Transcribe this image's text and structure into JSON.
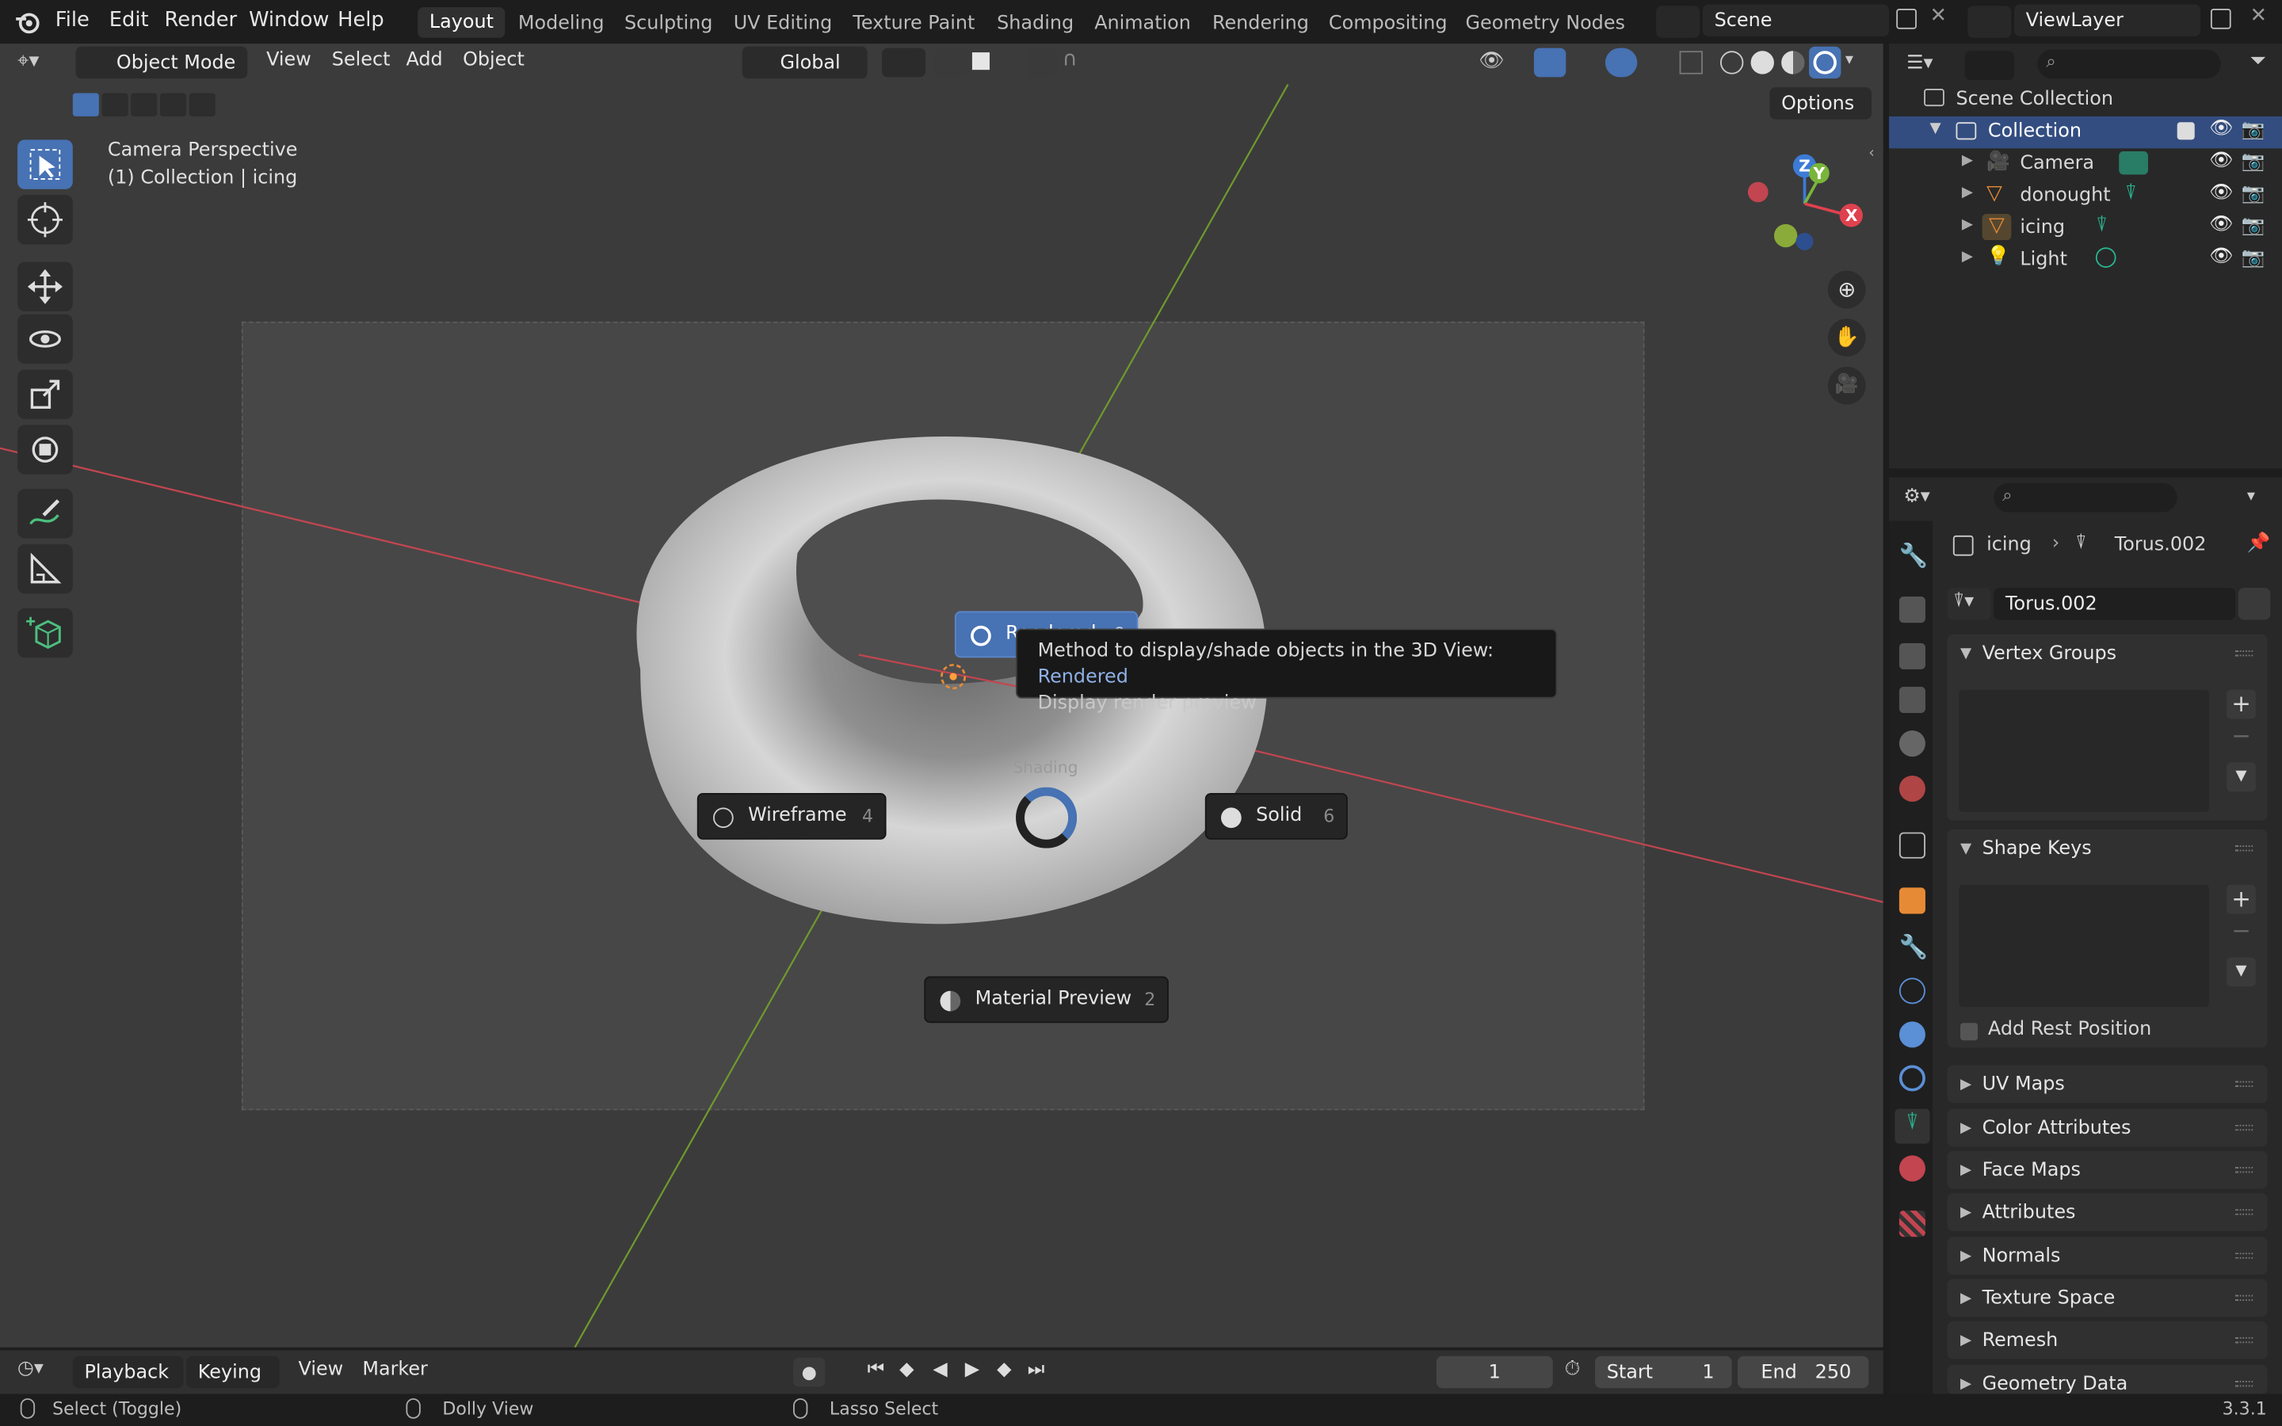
{
  "topbar": {
    "menus": [
      "File",
      "Edit",
      "Render",
      "Window",
      "Help"
    ],
    "workspaces": [
      "Layout",
      "Modeling",
      "Sculpting",
      "UV Editing",
      "Texture Paint",
      "Shading",
      "Animation",
      "Rendering",
      "Compositing",
      "Geometry Nodes"
    ],
    "active_workspace": "Layout",
    "scene": "Scene",
    "view_layer": "ViewLayer"
  },
  "viewport_header": {
    "mode": "Object Mode",
    "menus": [
      "View",
      "Select",
      "Add",
      "Object"
    ],
    "orientation": "Global",
    "options": "Options"
  },
  "viewport": {
    "view_name": "Camera Perspective",
    "collection_info": "(1) Collection | icing",
    "gizmo_axes": [
      "X",
      "Y",
      "Z"
    ]
  },
  "pie_menu": {
    "title": "Shading",
    "items": {
      "rendered": {
        "label": "Rendered",
        "key": "8"
      },
      "wireframe": {
        "label": "Wireframe",
        "key": "4"
      },
      "solid": {
        "label": "Solid",
        "key": "6"
      },
      "material": {
        "label": "Material Preview",
        "key": "2"
      }
    }
  },
  "tooltip": {
    "line1": "Method to display/shade objects in the 3D View:",
    "value": "Rendered",
    "line2": "Display render preview"
  },
  "outliner": {
    "root": "Scene Collection",
    "collection": "Collection",
    "items": [
      "Camera",
      "donought",
      "icing",
      "Light"
    ]
  },
  "properties": {
    "breadcrumb_object": "icing",
    "breadcrumb_data": "Torus.002",
    "mesh_name": "Torus.002",
    "panels": {
      "vertex_groups": "Vertex Groups",
      "shape_keys": "Shape Keys",
      "add_rest_position": "Add Rest Position",
      "collapsed": [
        "UV Maps",
        "Color Attributes",
        "Face Maps",
        "Attributes",
        "Normals",
        "Texture Space",
        "Remesh",
        "Geometry Data"
      ]
    }
  },
  "timeline": {
    "menus": [
      "Playback",
      "Keying",
      "View",
      "Marker"
    ],
    "current_frame": "1",
    "start_label": "Start",
    "start": "1",
    "end_label": "End",
    "end": "250"
  },
  "statusbar": {
    "left": "Select (Toggle)",
    "middle": "Dolly View",
    "right": "Lasso Select",
    "version": "3.3.1"
  },
  "colors": {
    "accent": "#4772b3",
    "x_axis": "#e0414f",
    "y_axis": "#7ab53a",
    "z_axis": "#3c7bd6",
    "object_orange": "#e68a36",
    "data_green": "#29b48e"
  }
}
